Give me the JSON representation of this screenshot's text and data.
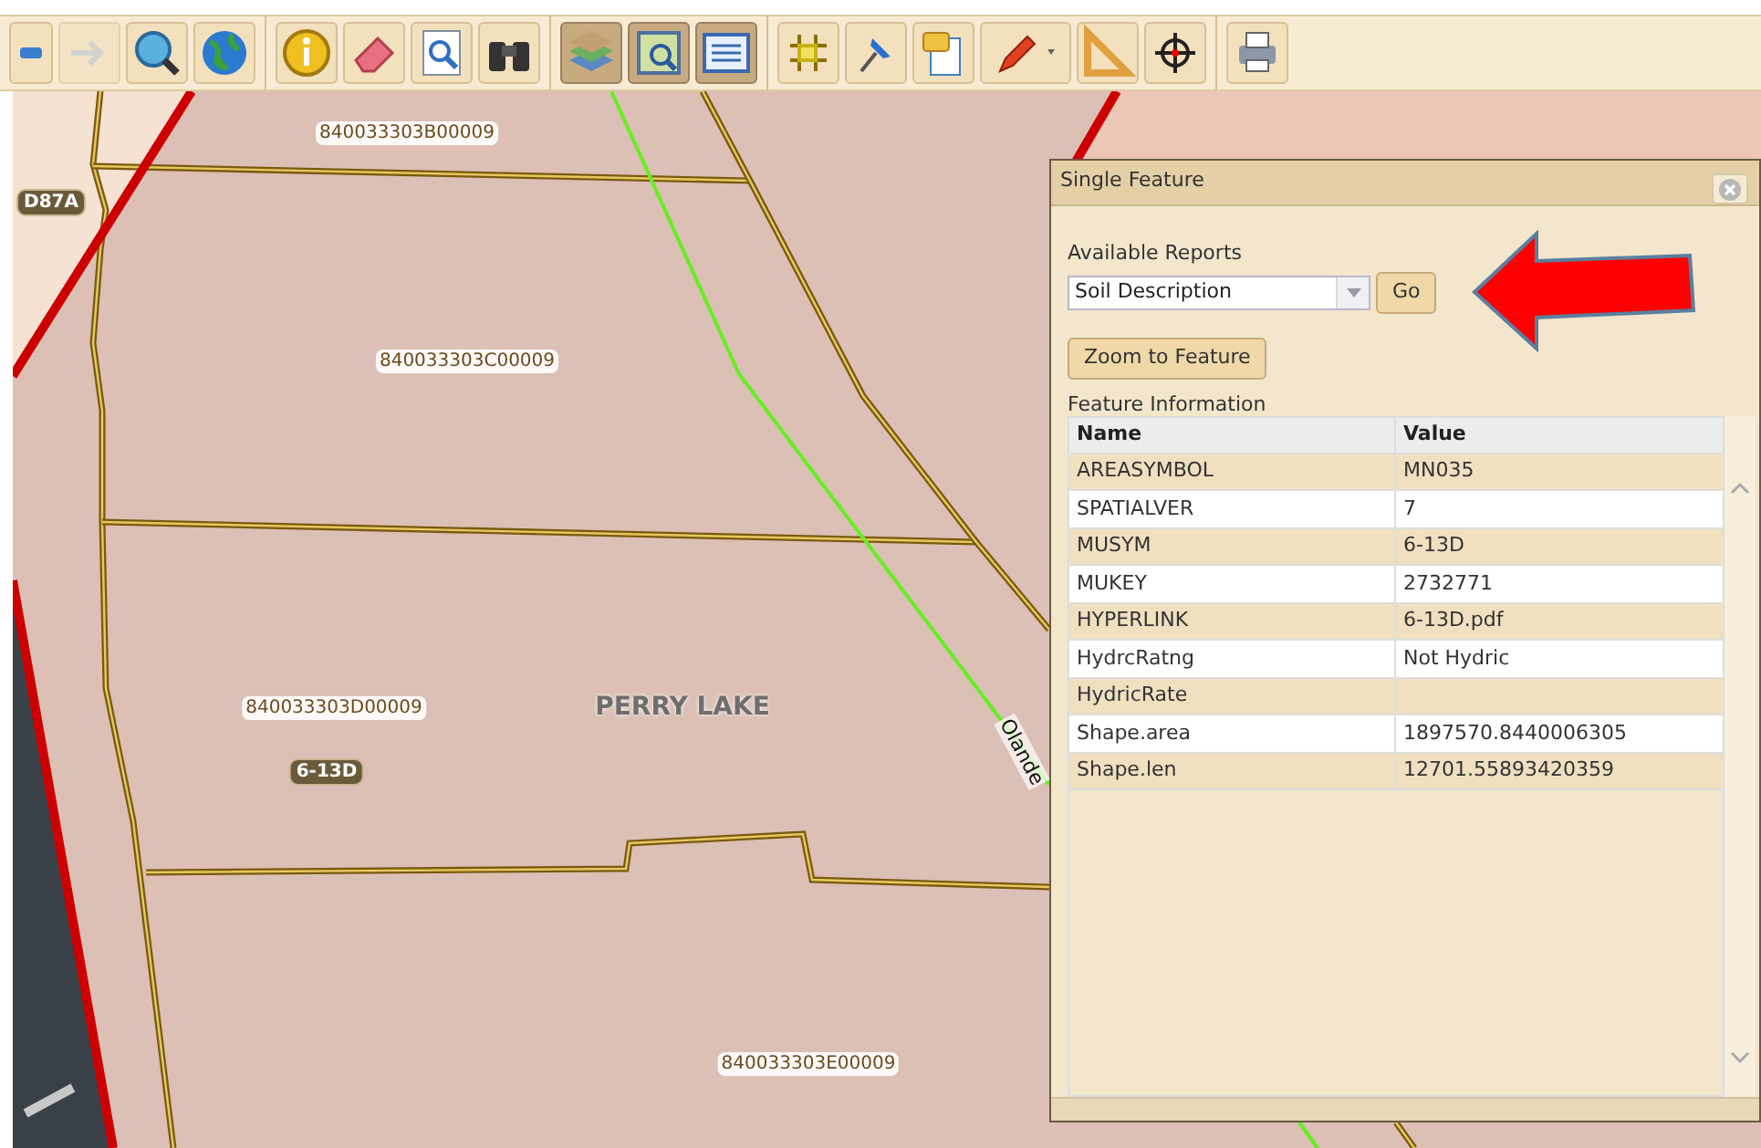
{
  "toolbar": {
    "groups": [
      [
        {
          "kind": "minus",
          "pressed": false,
          "disabled": false
        },
        {
          "kind": "forward",
          "pressed": false,
          "disabled": true
        },
        {
          "kind": "zoom-globe",
          "pressed": false,
          "disabled": false
        },
        {
          "kind": "globe",
          "pressed": false,
          "disabled": false
        }
      ],
      [
        {
          "kind": "info",
          "pressed": false,
          "disabled": false
        },
        {
          "kind": "eraser",
          "pressed": false,
          "disabled": false
        },
        {
          "kind": "page-search",
          "pressed": false,
          "disabled": false
        },
        {
          "kind": "binoculars",
          "pressed": false,
          "disabled": false
        }
      ],
      [
        {
          "kind": "layers",
          "pressed": true,
          "disabled": false
        },
        {
          "kind": "map-zoom",
          "pressed": true,
          "disabled": false
        },
        {
          "kind": "list",
          "pressed": true,
          "disabled": false
        }
      ],
      [
        {
          "kind": "grid",
          "pressed": false,
          "disabled": false
        },
        {
          "kind": "pin",
          "pressed": false,
          "disabled": false
        },
        {
          "kind": "note",
          "pressed": false,
          "disabled": false
        },
        {
          "kind": "pencil",
          "pressed": false,
          "disabled": false
        },
        {
          "kind": "triangle",
          "pressed": false,
          "disabled": false
        },
        {
          "kind": "crosshair",
          "pressed": false,
          "disabled": false
        }
      ],
      [
        {
          "kind": "printer",
          "pressed": false,
          "disabled": false
        }
      ]
    ]
  },
  "map": {
    "labels": [
      {
        "text": "840033303B00009",
        "kind": "parcel"
      },
      {
        "text": "D87A",
        "kind": "soil"
      },
      {
        "text": "840033303C00009",
        "kind": "parcel"
      },
      {
        "text": "840033303D00009",
        "kind": "parcel"
      },
      {
        "text": "PERRY LAKE",
        "kind": "place"
      },
      {
        "text": "6-13D",
        "kind": "soil"
      },
      {
        "text": "Olande",
        "kind": "road"
      },
      {
        "text": "840033303E00009",
        "kind": "parcel"
      }
    ]
  },
  "panel": {
    "title": "Single Feature",
    "reports_label": "Available Reports",
    "report": "Soil Description",
    "go": "Go",
    "zoom": "Zoom to Feature",
    "info_label": "Feature Information",
    "table": {
      "columns": [
        "Name",
        "Value"
      ],
      "rows": [
        [
          "AREASYMBOL",
          "MN035"
        ],
        [
          "SPATIALVER",
          "7"
        ],
        [
          "MUSYM",
          "6-13D"
        ],
        [
          "MUKEY",
          "2732771"
        ],
        [
          "HYPERLINK",
          "6-13D.pdf"
        ],
        [
          "HydrcRatng",
          "Not Hydric"
        ],
        [
          "HydricRate",
          ""
        ],
        [
          "Shape.area",
          "1897570.8440006305"
        ],
        [
          "Shape.len",
          "12701.55893420359"
        ]
      ]
    }
  }
}
